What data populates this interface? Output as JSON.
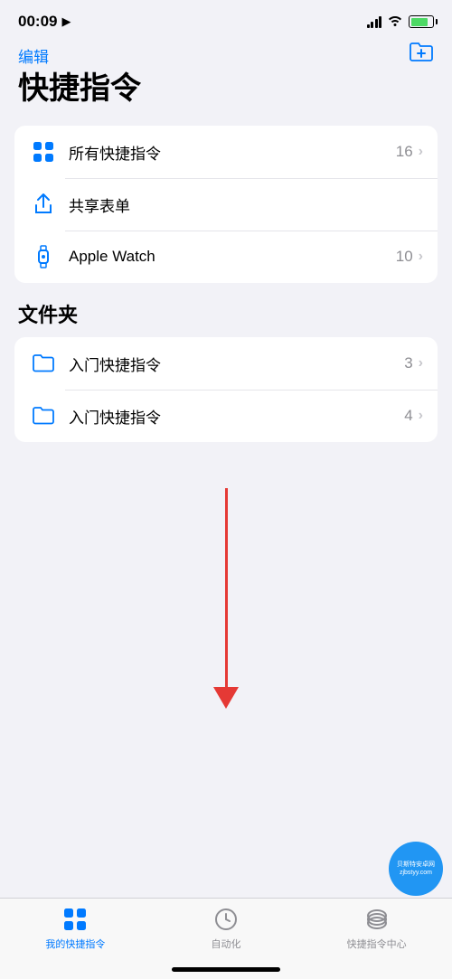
{
  "statusBar": {
    "time": "00:09",
    "locationIcon": "◂"
  },
  "header": {
    "editLabel": "编辑",
    "pageTitle": "快捷指令"
  },
  "shortcuts": {
    "sectionItems": [
      {
        "id": "all",
        "label": "所有快捷指令",
        "count": "16",
        "hasChevron": true,
        "iconType": "grid"
      },
      {
        "id": "share",
        "label": "共享表单",
        "count": "",
        "hasChevron": false,
        "iconType": "share"
      },
      {
        "id": "watch",
        "label": "Apple Watch",
        "count": "10",
        "hasChevron": true,
        "iconType": "watch"
      }
    ]
  },
  "folders": {
    "sectionTitle": "文件夹",
    "sectionItems": [
      {
        "id": "folder1",
        "label": "入门快捷指令",
        "count": "3",
        "hasChevron": true,
        "iconType": "folder"
      },
      {
        "id": "folder2",
        "label": "入门快捷指令",
        "count": "4",
        "hasChevron": true,
        "iconType": "folder"
      }
    ]
  },
  "tabBar": {
    "tabs": [
      {
        "id": "my-shortcuts",
        "label": "我的快捷指令",
        "active": true
      },
      {
        "id": "automation",
        "label": "自动化",
        "active": false
      },
      {
        "id": "gallery",
        "label": "快捷指令中心",
        "active": false
      }
    ]
  },
  "watermark": {
    "text": "贝斯特安卓网\nwww.zjbstyy.com"
  }
}
